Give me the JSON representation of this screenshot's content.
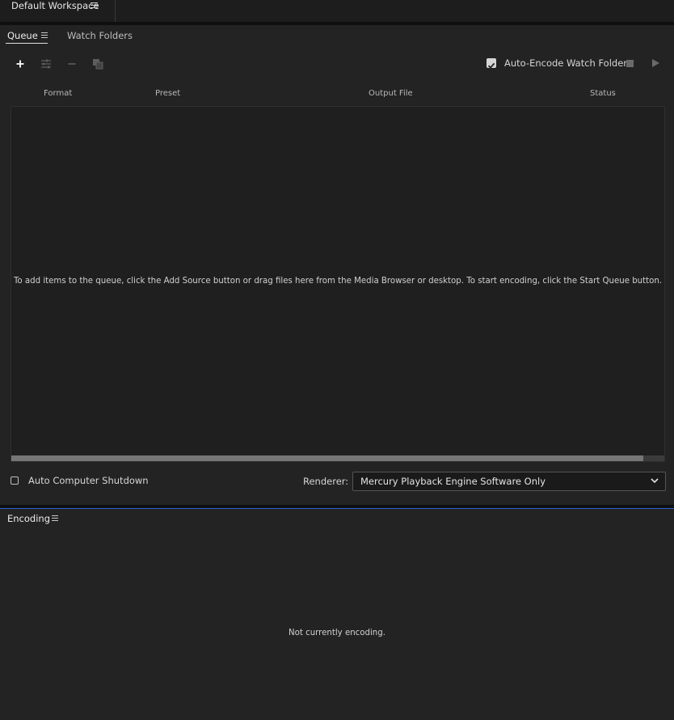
{
  "workspace": {
    "label": "Default Workspace"
  },
  "queue": {
    "tabs": [
      {
        "label": "Queue",
        "active": true
      },
      {
        "label": "Watch Folders",
        "active": false
      }
    ],
    "toolbar": {
      "icons": [
        "add-icon",
        "settings-icon",
        "remove-icon",
        "duplicate-icon"
      ],
      "auto_encode_label": "Auto-Encode Watch Folders",
      "auto_encode_checked": true
    },
    "columns": [
      "Format",
      "Preset",
      "Output File",
      "Status"
    ],
    "empty_hint": "To add items to the queue, click the Add Source button or drag files here from the Media Browser or desktop.  To start encoding, click the Start Queue button.",
    "shutdown_label": "Auto Computer Shutdown",
    "shutdown_checked": false,
    "renderer_label": "Renderer:",
    "renderer_value": "Mercury Playback Engine Software Only"
  },
  "encoding": {
    "tab_label": "Encoding",
    "status_text": "Not currently encoding."
  },
  "colors": {
    "background": "#232323",
    "accent_separator": "#2f5fcf"
  }
}
